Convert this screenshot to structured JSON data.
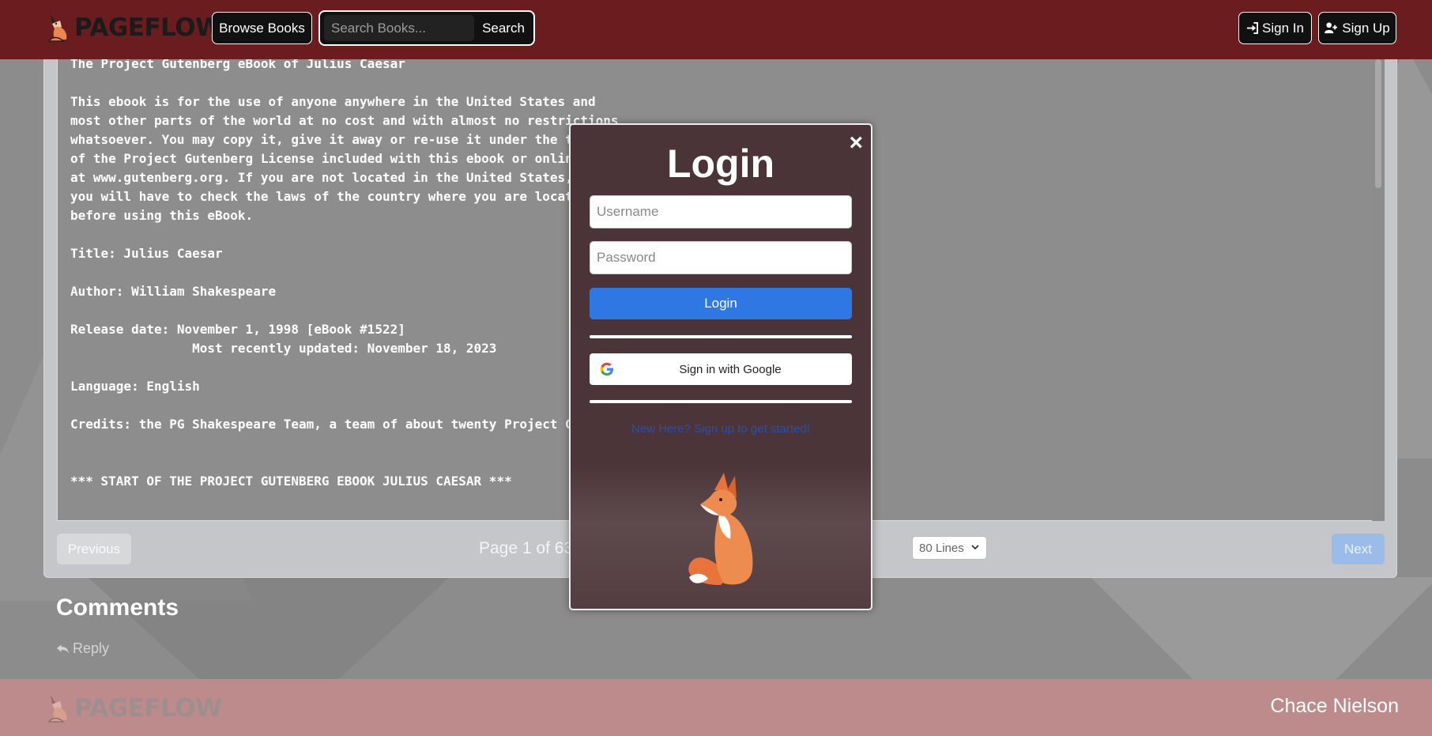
{
  "header": {
    "logo_text": "PAGEFLOW",
    "browse_label": "Browse Books",
    "search_placeholder": "Search Books...",
    "search_label": "Search",
    "signin_label": "Sign In",
    "signup_label": "Sign Up"
  },
  "reader": {
    "lines": [
      "The Project Gutenberg eBook of Julius Caesar",
      "",
      "This ebook is for the use of anyone anywhere in the United States and",
      "most other parts of the world at no cost and with almost no restrictions",
      "whatsoever. You may copy it, give it away or re-use it under the terms",
      "of the Project Gutenberg License included with this ebook or online",
      "at www.gutenberg.org. If you are not located in the United States,",
      "you will have to check the laws of the country where you are located",
      "before using this eBook.",
      "",
      "Title: Julius Caesar",
      "",
      "Author: William Shakespeare",
      "",
      "Release date: November 1, 1998 [eBook #1522]",
      "                Most recently updated: November 18, 2023",
      "",
      "Language: English",
      "",
      "Credits: the PG Shakespeare Team, a team of about twenty Project Gutenberg volunteers",
      "",
      "",
      "*** START OF THE PROJECT GUTENBERG EBOOK JULIUS CAESAR ***"
    ],
    "prev_label": "Previous",
    "page_info": "Page 1 of 63",
    "lines_option": "80 Lines",
    "next_label": "Next"
  },
  "comments": {
    "title": "Comments",
    "reply_label": "Reply"
  },
  "footer": {
    "logo_text": "PAGEFLOW",
    "author": "Chace Nielson"
  },
  "login_modal": {
    "close": "×",
    "title": "Login",
    "username_placeholder": "Username",
    "password_placeholder": "Password",
    "login_label": "Login",
    "google_label": "Sign in with Google",
    "signup_link": "New Here? Sign up to get started!"
  },
  "colors": {
    "header_bg": "#6b1c1f",
    "footer_bg": "#bd8b8c",
    "modal_bg": "#4a3437",
    "primary": "#2f78e4"
  }
}
